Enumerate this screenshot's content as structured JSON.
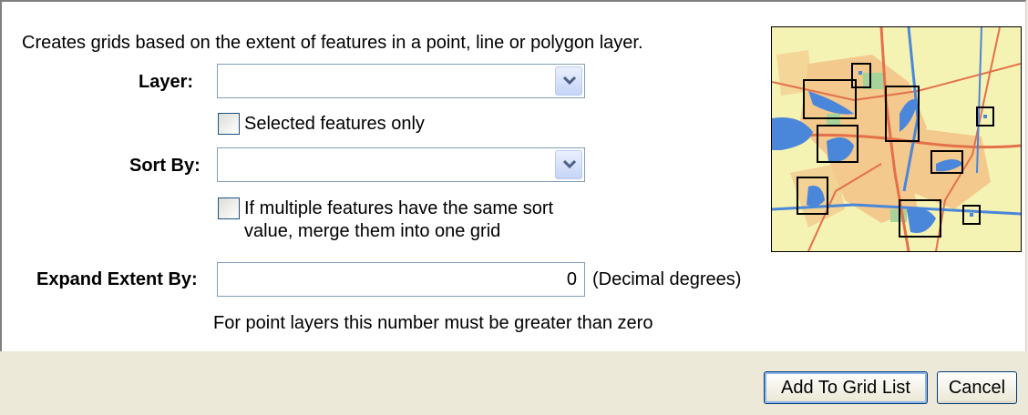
{
  "description": "Creates grids based on the extent of features in a point, line or polygon layer.",
  "layer": {
    "label": "Layer:",
    "value": ""
  },
  "selected_only": {
    "label": "Selected features only",
    "checked": false
  },
  "sort_by": {
    "label": "Sort By:",
    "value": ""
  },
  "merge_option": {
    "line1": "If multiple features have the same sort",
    "line2": "value, merge them into one grid",
    "checked": false
  },
  "expand_extent": {
    "label": "Expand Extent By:",
    "value": "0",
    "unit": "(Decimal degrees)",
    "hint": "For point layers this number must be greater than zero"
  },
  "buttons": {
    "add": "Add To Grid List",
    "cancel": "Cancel"
  },
  "colors": {
    "map_background": "#f5f3b4",
    "urban": "#f3c98d",
    "water": "#4a86d9",
    "roads": "#e4704a",
    "dialog_background": "#ece9d8"
  }
}
